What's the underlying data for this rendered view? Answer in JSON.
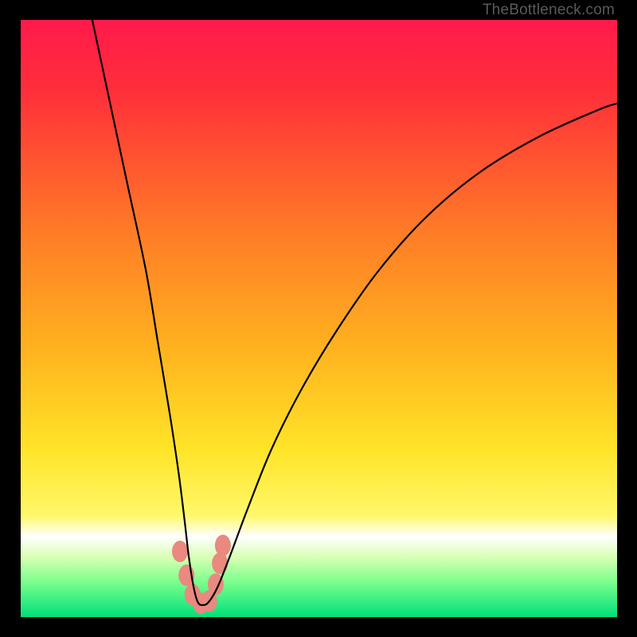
{
  "watermark": "TheBottleneck.com",
  "chart_data": {
    "type": "line",
    "title": "",
    "xlabel": "",
    "ylabel": "",
    "xlim": [
      0,
      100
    ],
    "ylim": [
      0,
      100
    ],
    "grid": false,
    "legend": false,
    "background_gradient": {
      "stops": [
        {
          "offset": 0.0,
          "color": "#ff1a4b"
        },
        {
          "offset": 0.12,
          "color": "#ff2f3a"
        },
        {
          "offset": 0.35,
          "color": "#ff7a27"
        },
        {
          "offset": 0.55,
          "color": "#ffb21f"
        },
        {
          "offset": 0.72,
          "color": "#ffe428"
        },
        {
          "offset": 0.83,
          "color": "#fff86a"
        },
        {
          "offset": 0.865,
          "color": "#ffffff"
        },
        {
          "offset": 0.9,
          "color": "#d8ffb4"
        },
        {
          "offset": 0.94,
          "color": "#7dff8d"
        },
        {
          "offset": 1.0,
          "color": "#00e07a"
        }
      ]
    },
    "series": [
      {
        "name": "bottleneck-curve",
        "color": "#000000",
        "x": [
          12,
          15,
          18,
          21,
          23,
          25,
          26.5,
          27.5,
          28.2,
          29,
          29.7,
          30.5,
          31.5,
          33,
          35,
          38,
          42,
          47,
          53,
          60,
          68,
          77,
          87,
          97,
          100
        ],
        "y": [
          100,
          86,
          72,
          58,
          46,
          34,
          24,
          16,
          10,
          5,
          2.5,
          2,
          2.5,
          5,
          10,
          18,
          28,
          38,
          48,
          58,
          67,
          74.5,
          80.5,
          85,
          86
        ]
      }
    ],
    "markers": [
      {
        "name": "highlight-dots",
        "color": "#e9897f",
        "points": [
          {
            "x": 26.7,
            "y": 11.0
          },
          {
            "x": 27.8,
            "y": 7.0
          },
          {
            "x": 28.8,
            "y": 3.8
          },
          {
            "x": 30.2,
            "y": 2.3
          },
          {
            "x": 31.6,
            "y": 2.7
          },
          {
            "x": 32.7,
            "y": 5.5
          },
          {
            "x": 33.4,
            "y": 9.0
          },
          {
            "x": 33.9,
            "y": 12.0
          }
        ],
        "radius": 10
      }
    ]
  }
}
